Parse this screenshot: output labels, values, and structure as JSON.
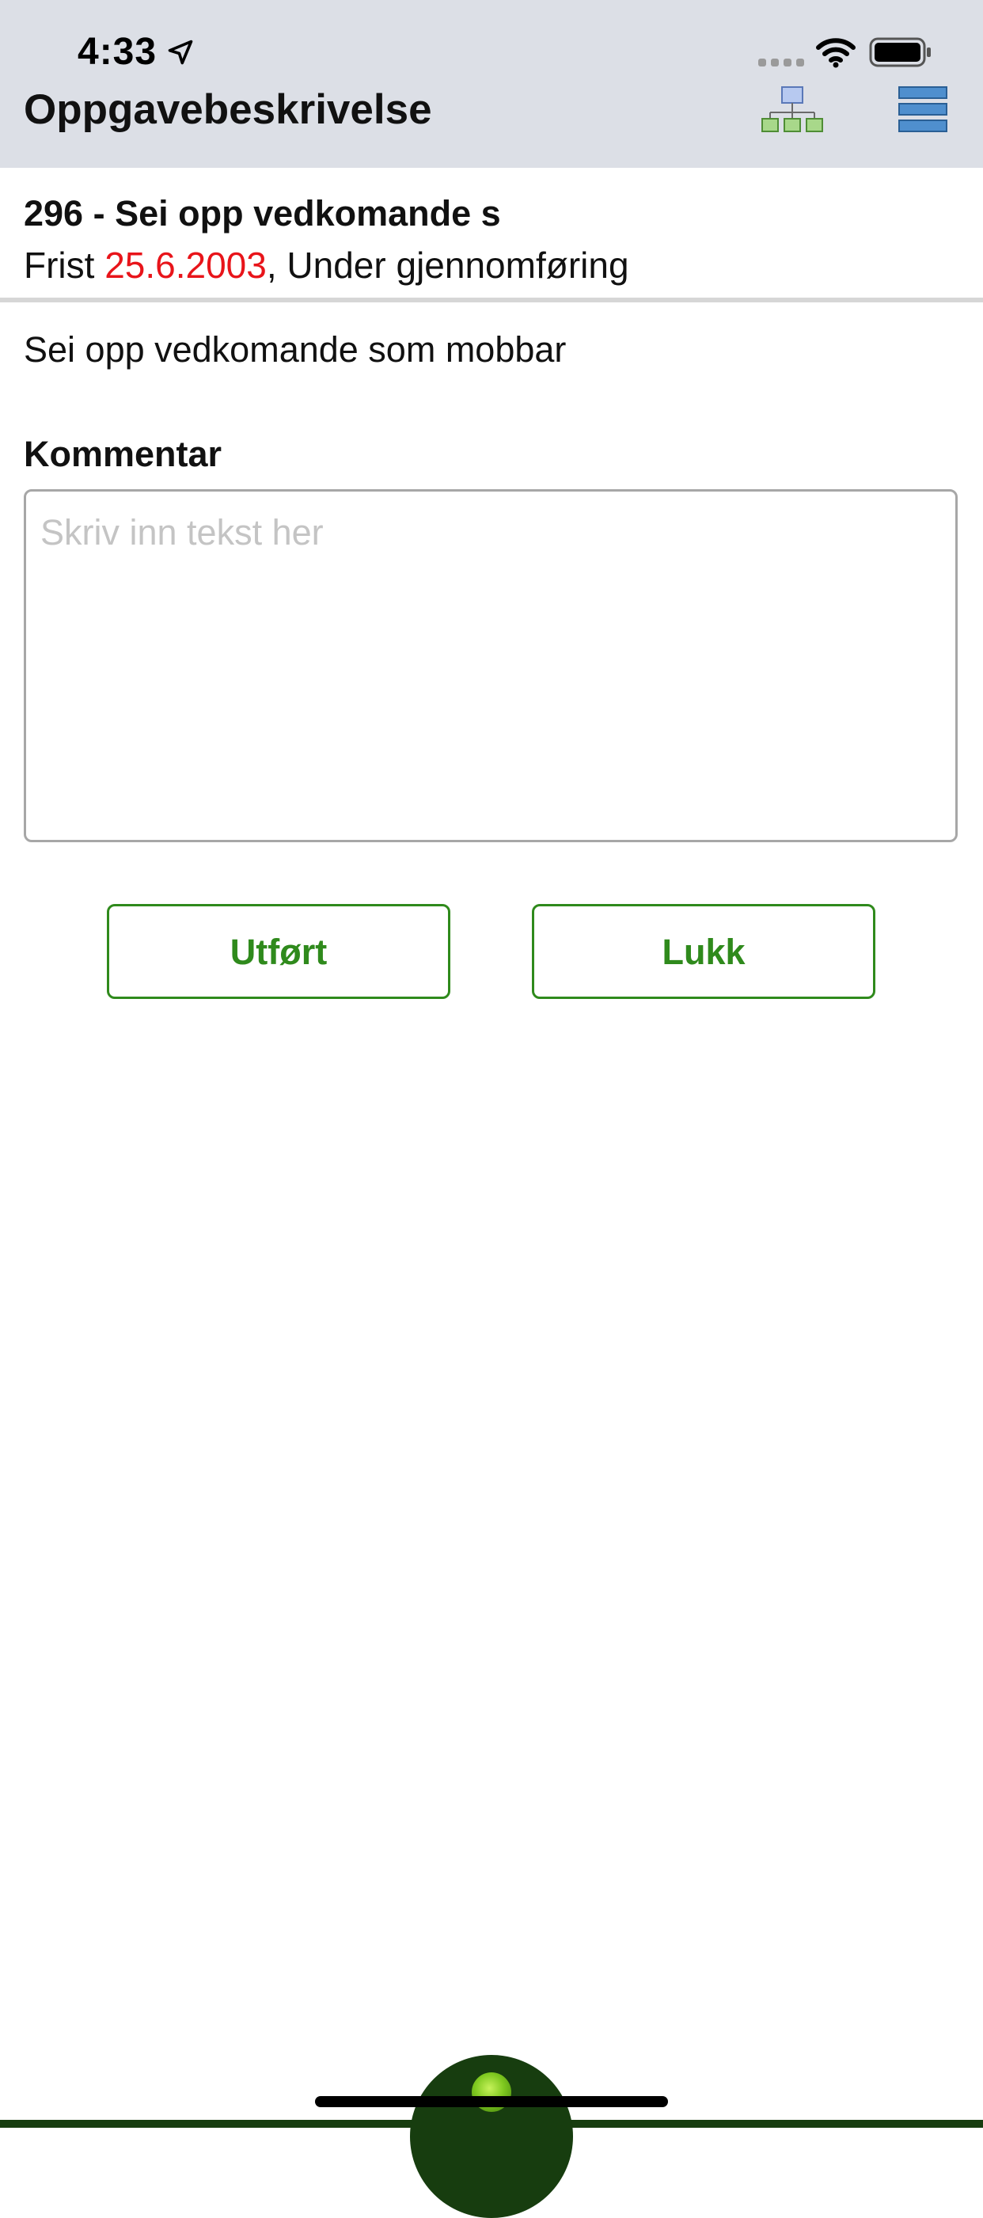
{
  "status_bar": {
    "time": "4:33"
  },
  "header": {
    "title": "Oppgavebeskrivelse",
    "org_icon": "org-chart-icon",
    "menu_icon": "list-menu-icon"
  },
  "task": {
    "title": "296 - Sei opp vedkomande s",
    "deadline_label": "Frist ",
    "deadline_date": "25.6.2003",
    "status": ", Under gjennomføring",
    "description": "Sei opp vedkomande som mobbar"
  },
  "comment": {
    "label": "Kommentar",
    "placeholder": "Skriv inn tekst her",
    "value": ""
  },
  "actions": {
    "done_label": "Utført",
    "close_label": "Lukk"
  },
  "colors": {
    "header_bg": "#dcdfe6",
    "accent_green": "#2f8a1c",
    "deadline_red": "#e8141a",
    "bottom_bar": "#173d0f"
  }
}
